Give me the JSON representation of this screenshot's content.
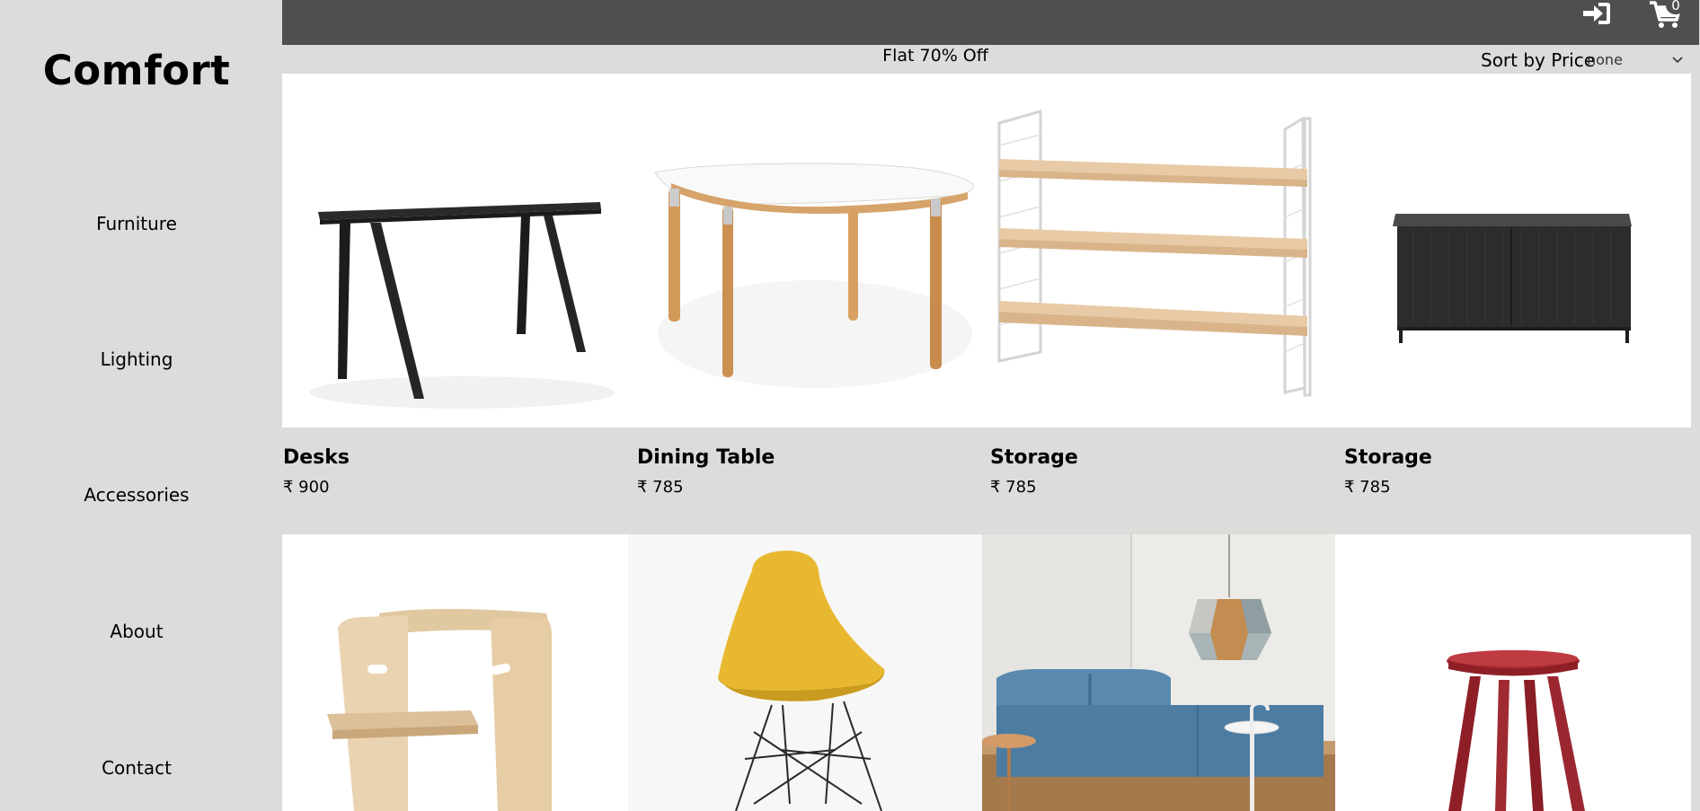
{
  "brand": {
    "name": "Comfort"
  },
  "nav": {
    "items": [
      {
        "label": "Furniture"
      },
      {
        "label": "Lighting"
      },
      {
        "label": "Accessories"
      },
      {
        "label": "About"
      },
      {
        "label": "Contact"
      }
    ]
  },
  "header": {
    "login_icon": "sign-in-icon",
    "cart_icon": "shopping-cart-icon",
    "cart_count": "0"
  },
  "promo": {
    "text": "Flat 70% Off"
  },
  "sort": {
    "label": "Sort by Price",
    "selected": "none"
  },
  "products": [
    {
      "name": "Desks",
      "price": "₹ 900"
    },
    {
      "name": "Dining Table",
      "price": "₹ 785"
    },
    {
      "name": "Storage",
      "price": "₹ 785"
    },
    {
      "name": "Storage",
      "price": "₹ 785"
    }
  ],
  "colors": {
    "sidebar_bg": "#dcdcdb",
    "topbar_bg": "#4f4f4f",
    "card_bg": "#ffffff"
  }
}
